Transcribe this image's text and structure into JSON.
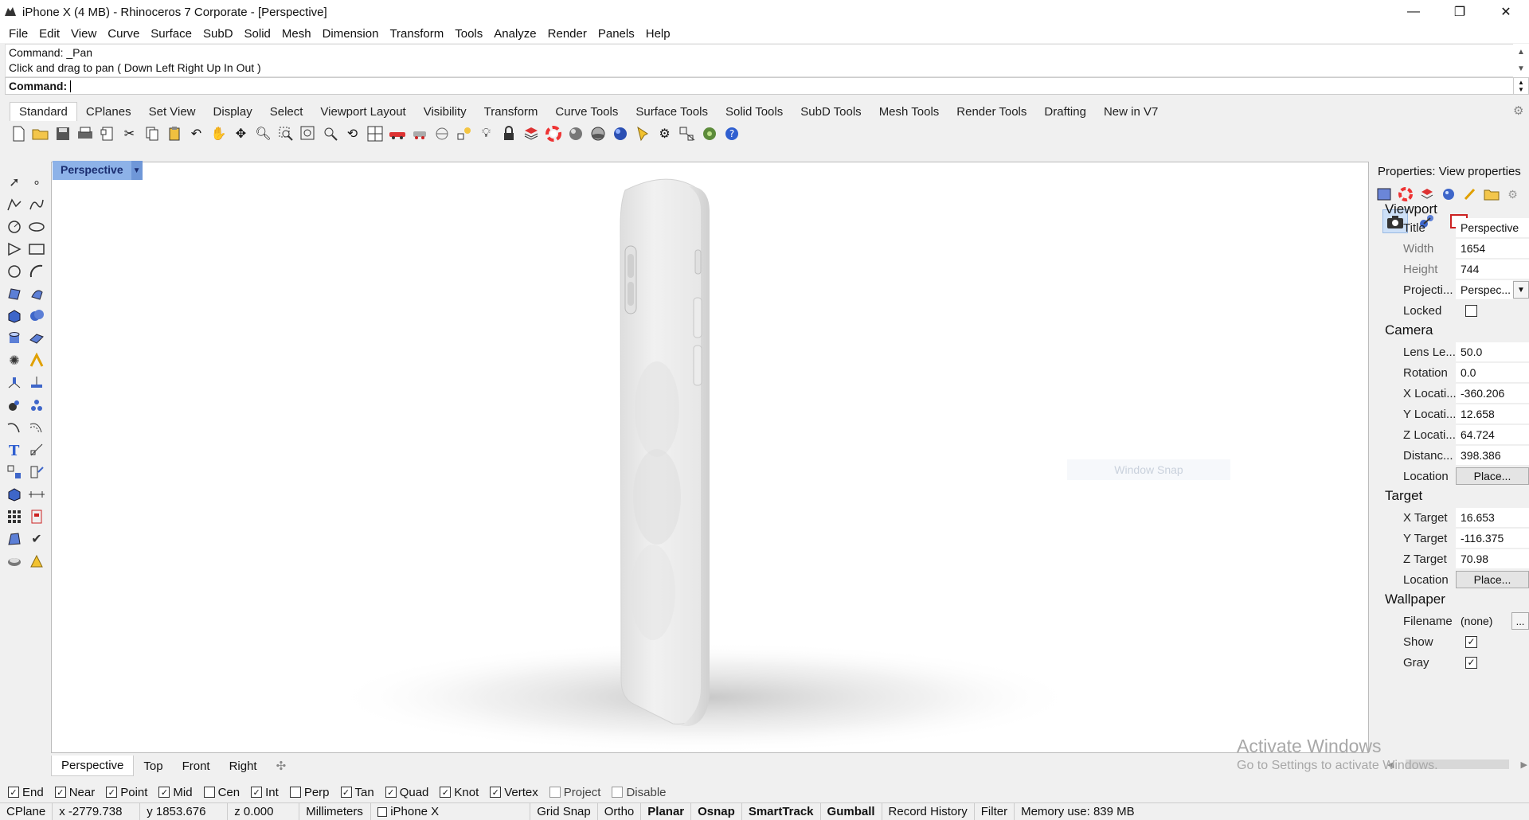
{
  "window": {
    "title": "iPhone X (4 MB) - Rhinoceros 7 Corporate - [Perspective]",
    "minimize": "—",
    "restore": "❐",
    "close": "✕"
  },
  "menu": [
    "File",
    "Edit",
    "View",
    "Curve",
    "Surface",
    "SubD",
    "Solid",
    "Mesh",
    "Dimension",
    "Transform",
    "Tools",
    "Analyze",
    "Render",
    "Panels",
    "Help"
  ],
  "command": {
    "history_1": "Command: _Pan",
    "history_2": "Click and drag to pan ( Down  Left  Right  Up  In  Out )",
    "prompt": "Command:"
  },
  "toolbar_tabs": [
    "Standard",
    "CPlanes",
    "Set View",
    "Display",
    "Select",
    "Viewport Layout",
    "Visibility",
    "Transform",
    "Curve Tools",
    "Surface Tools",
    "Solid Tools",
    "SubD Tools",
    "Mesh Tools",
    "Render Tools",
    "Drafting",
    "New in V7"
  ],
  "viewport": {
    "title": "Perspective",
    "snap_ghost": "Window Snap",
    "tabs": [
      "Perspective",
      "Top",
      "Front",
      "Right"
    ],
    "add_tab": "✣"
  },
  "properties": {
    "header": "Properties: View properties",
    "viewport_section": "Viewport",
    "title_label": "Title",
    "title_value": "Perspective",
    "width_label": "Width",
    "width_value": "1654",
    "height_label": "Height",
    "height_value": "744",
    "projection_label": "Projecti...",
    "projection_value": "Perspec...",
    "locked_label": "Locked",
    "camera_section": "Camera",
    "lens_label": "Lens Le...",
    "lens_value": "50.0",
    "rotation_label": "Rotation",
    "rotation_value": "0.0",
    "xloc_label": "X Locati...",
    "xloc_value": "-360.206",
    "yloc_label": "Y Locati...",
    "yloc_value": "12.658",
    "zloc_label": "Z Locati...",
    "zloc_value": "64.724",
    "dist_label": "Distanc...",
    "dist_value": "398.386",
    "cam_location_label": "Location",
    "cam_location_button": "Place...",
    "target_section": "Target",
    "xt_label": "X Target",
    "xt_value": "16.653",
    "yt_label": "Y Target",
    "yt_value": "-116.375",
    "zt_label": "Z Target",
    "zt_value": "70.98",
    "tgt_location_label": "Location",
    "tgt_location_button": "Place...",
    "wallpaper_section": "Wallpaper",
    "filename_label": "Filename",
    "filename_value": "(none)",
    "filename_button": "...",
    "show_label": "Show",
    "gray_label": "Gray",
    "check_mark": "✓"
  },
  "watermark": {
    "line1": "Activate Windows",
    "line2": "Go to Settings to activate Windows."
  },
  "osnap": {
    "items": [
      "End",
      "Near",
      "Point",
      "Mid",
      "Cen",
      "Int",
      "Perp",
      "Tan",
      "Quad",
      "Knot",
      "Vertex",
      "Project",
      "Disable"
    ],
    "checked": [
      true,
      true,
      true,
      true,
      false,
      true,
      false,
      true,
      true,
      true,
      true,
      false,
      false
    ],
    "check_mark": "✓"
  },
  "status": {
    "cplane": "CPlane",
    "x": "x -2779.738",
    "y": "y 1853.676",
    "z": "z 0.000",
    "units": "Millimeters",
    "layer": "iPhone X",
    "grid_snap": "Grid Snap",
    "ortho": "Ortho",
    "planar": "Planar",
    "osnap": "Osnap",
    "smarttrack": "SmartTrack",
    "gumball": "Gumball",
    "record_history": "Record History",
    "filter": "Filter",
    "memory": "Memory use: 839 MB"
  }
}
